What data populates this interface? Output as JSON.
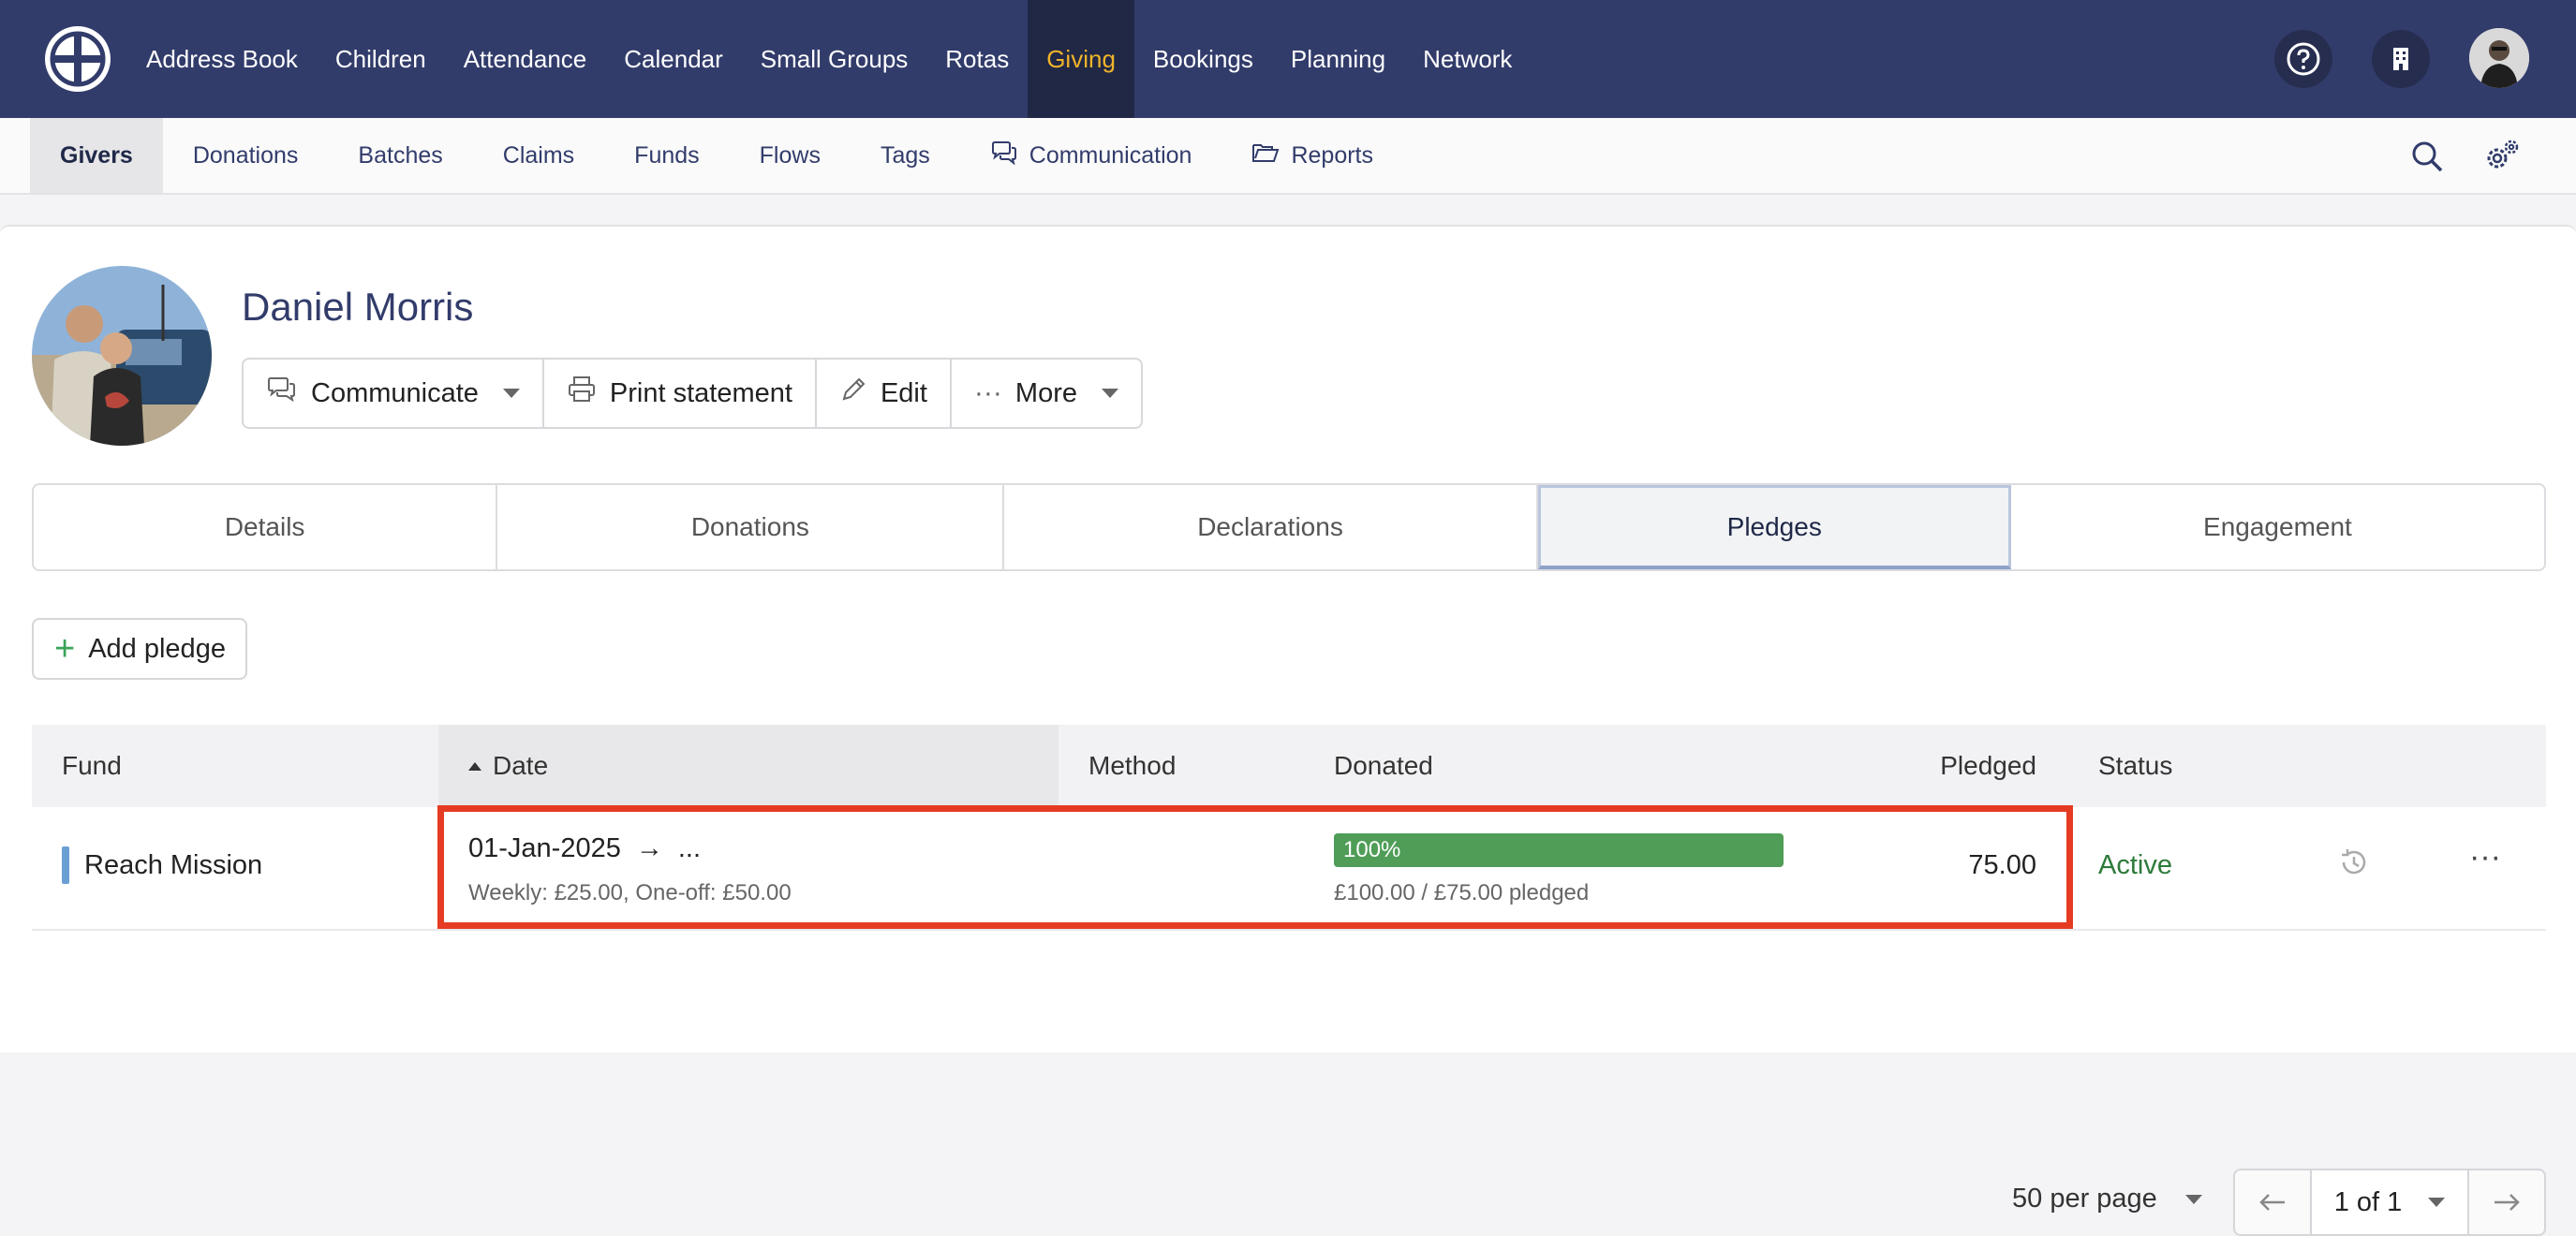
{
  "topnav": {
    "items": [
      {
        "label": "Address Book"
      },
      {
        "label": "Children"
      },
      {
        "label": "Attendance"
      },
      {
        "label": "Calendar"
      },
      {
        "label": "Small Groups"
      },
      {
        "label": "Rotas"
      },
      {
        "label": "Giving",
        "active": true
      },
      {
        "label": "Bookings"
      },
      {
        "label": "Planning"
      },
      {
        "label": "Network"
      }
    ],
    "icons": [
      "help-icon",
      "building-icon",
      "user-avatar"
    ],
    "active_color": "#f0b429",
    "bg_color": "#323c6b"
  },
  "subnav": {
    "items": [
      {
        "label": "Givers",
        "active": true
      },
      {
        "label": "Donations"
      },
      {
        "label": "Batches"
      },
      {
        "label": "Claims"
      },
      {
        "label": "Funds"
      },
      {
        "label": "Flows"
      },
      {
        "label": "Tags"
      },
      {
        "label": "Communication",
        "icon": "chat-icon"
      },
      {
        "label": "Reports",
        "icon": "folder-icon"
      }
    ],
    "right_icons": [
      "search-icon",
      "settings-icon"
    ]
  },
  "person": {
    "name": "Daniel Morris"
  },
  "actions": {
    "communicate": "Communicate",
    "print_statement": "Print statement",
    "edit": "Edit",
    "more": "More"
  },
  "tabs": [
    {
      "label": "Details"
    },
    {
      "label": "Donations"
    },
    {
      "label": "Declarations"
    },
    {
      "label": "Pledges",
      "active": true
    },
    {
      "label": "Engagement"
    }
  ],
  "add_pledge_label": "Add pledge",
  "table": {
    "headers": {
      "fund": "Fund",
      "date": "Date",
      "method": "Method",
      "donated": "Donated",
      "pledged": "Pledged",
      "status": "Status"
    },
    "rows": [
      {
        "fund": "Reach Mission",
        "date_start": "01-Jan-2025",
        "date_arrow": "→",
        "date_end": "...",
        "date_sub": "Weekly: £25.00, One-off: £50.00",
        "donated_percent_label": "100%",
        "donated_fraction": 1.0,
        "donated_sub": "£100.00 / £75.00 pledged",
        "pledged": "75.00",
        "status": "Active",
        "status_color": "#2d7a3a"
      }
    ]
  },
  "pagination": {
    "per_page": "50 per page",
    "page": "1 of 1"
  },
  "highlight_color": "#e53b22"
}
